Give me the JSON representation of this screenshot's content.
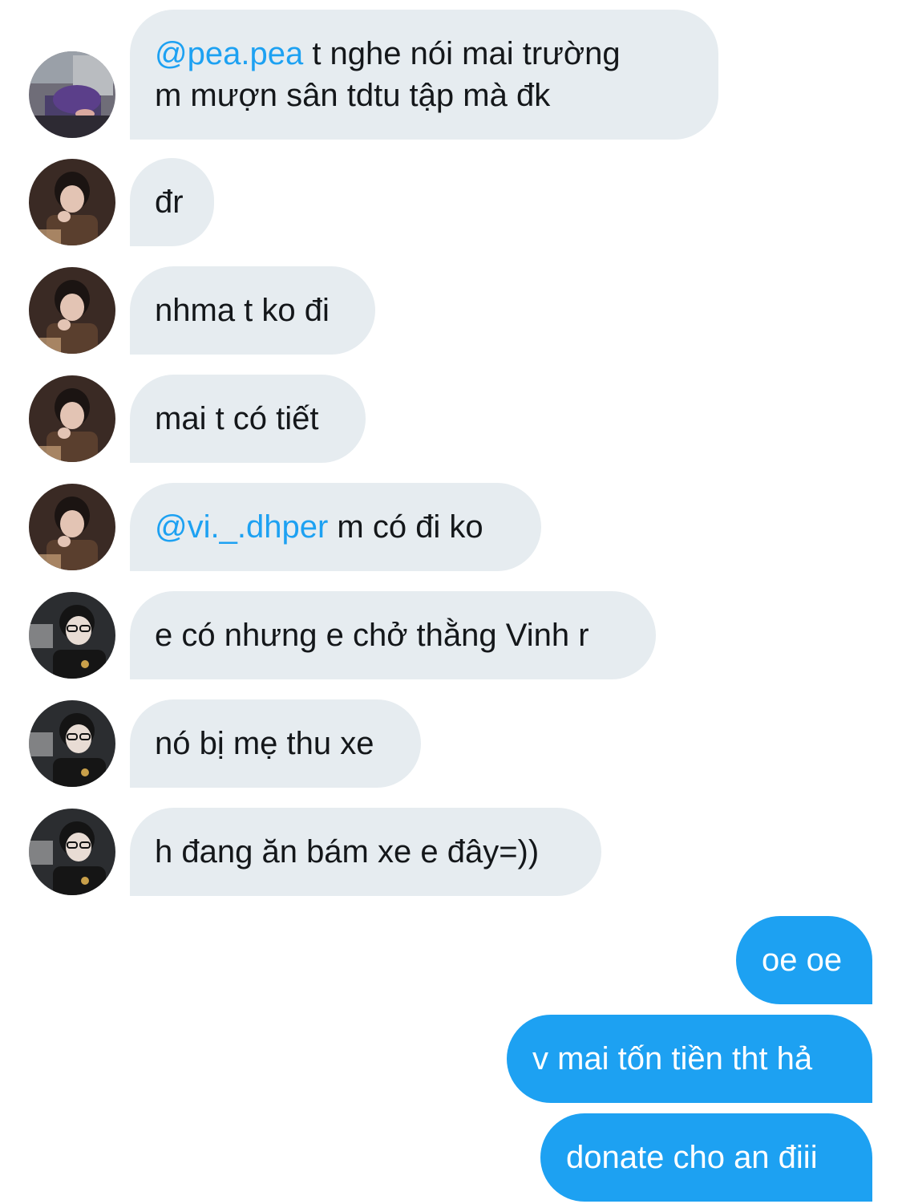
{
  "messages": [
    {
      "sender": "pea",
      "mention": "@pea.pea",
      "text": " t nghe nói mai trường",
      "text2": "m mượn sân tdtu tập mà đk"
    },
    {
      "sender": "boy",
      "text": "đr"
    },
    {
      "sender": "boy",
      "text": "nhma t ko đi"
    },
    {
      "sender": "boy",
      "text": "mai t có tiết"
    },
    {
      "sender": "boy",
      "mention": "@vi._.dhper",
      "text": " m có đi ko"
    },
    {
      "sender": "glasses",
      "text": "e có nhưng e chở thằng Vinh r"
    },
    {
      "sender": "glasses",
      "text": "nó bị mẹ thu xe"
    },
    {
      "sender": "glasses",
      "text": "h đang ăn bám xe e đây=))"
    }
  ],
  "my_messages": [
    {
      "text": "oe oe"
    },
    {
      "text": "v mai tốn tiền tht hả"
    },
    {
      "text": "donate cho an điii"
    }
  ],
  "colors": {
    "incoming_bubble": "#e6ecf0",
    "outgoing_bubble": "#1da1f2",
    "mention": "#1da1f2",
    "text": "#14171a"
  }
}
